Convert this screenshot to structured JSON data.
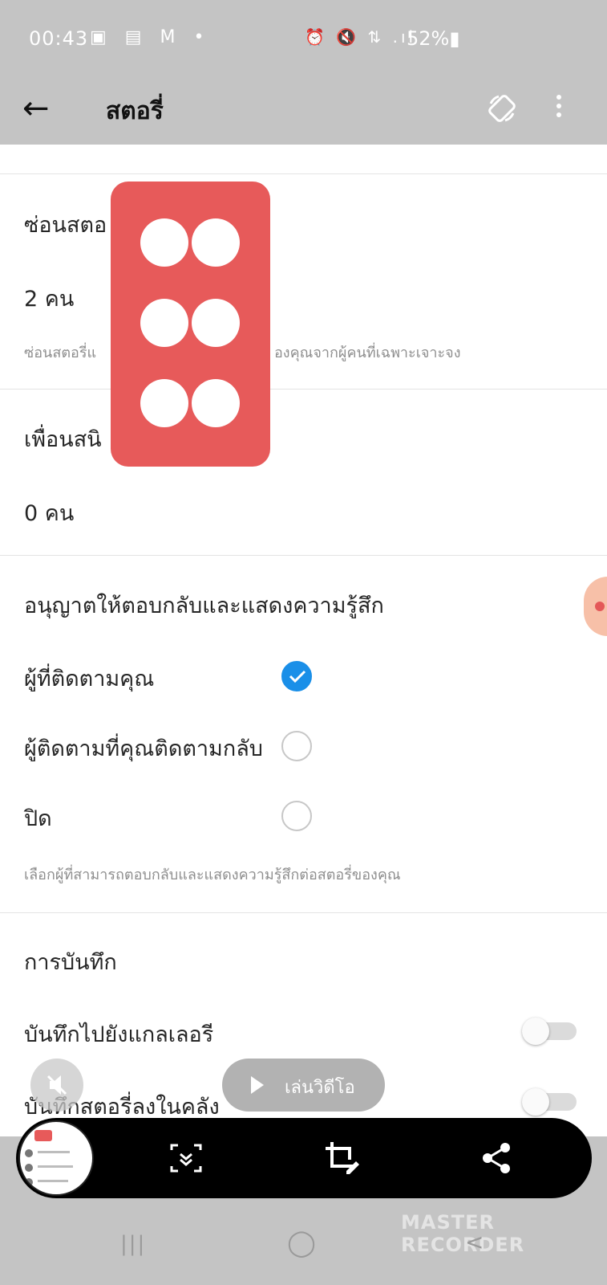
{
  "status_bar": {
    "time": "00:43",
    "left_icons": "▣ ▤ M •",
    "right_icons": "⏰ 🔇 ⇅ .ıl",
    "battery": "52%▮"
  },
  "app_bar": {
    "back_icon": "←",
    "title": "สตอรี่"
  },
  "sections": {
    "hide_story": {
      "title": "ซ่อนสตอ",
      "value": "2 คน",
      "description_left": "ซ่อนสตอรี่แ",
      "description_right": "องคุณจากผู้คนที่เฉพาะเจาะจง"
    },
    "close_friends": {
      "title": "เพื่อนสนิ",
      "value": "0 คน"
    },
    "replies": {
      "title": "อนุญาตให้ตอบกลับและแสดงความรู้สึก",
      "options": [
        {
          "label": "ผู้ที่ติดตามคุณ",
          "selected": true
        },
        {
          "label": "ผู้ติดตามที่คุณติดตามกลับ",
          "selected": false
        },
        {
          "label": "ปิด",
          "selected": false
        }
      ],
      "description": "เลือกผู้ที่สามารถตอบกลับและแสดงความรู้สึกต่อสตอรี่ของคุณ"
    },
    "saving": {
      "title": "การบันทึก",
      "items": [
        {
          "label": "บันทึกไปยังแกลเลอรี",
          "enabled": false
        },
        {
          "label": "บันทึกสตอรี่ลงในคลัง",
          "enabled": false
        }
      ]
    }
  },
  "overlay": {
    "play_label": "เล่นวิดีโอ",
    "mute_icon": "speaker-muted-icon"
  },
  "screenshot_toolbar": {
    "thumbnail_rows": [
      "____",
      "____",
      "____"
    ],
    "icons": [
      "scroll-capture-icon",
      "crop-edit-icon",
      "share-icon"
    ]
  },
  "watermark": "MASTER RECORDER",
  "nav_bar": {
    "recents_icon": "|||",
    "home_icon": "◯",
    "back_icon": "<"
  },
  "colors": {
    "accent_blue": "#1a8fe8",
    "blocker_red": "#e75a5a",
    "status_gray": "#c4c4c4"
  }
}
